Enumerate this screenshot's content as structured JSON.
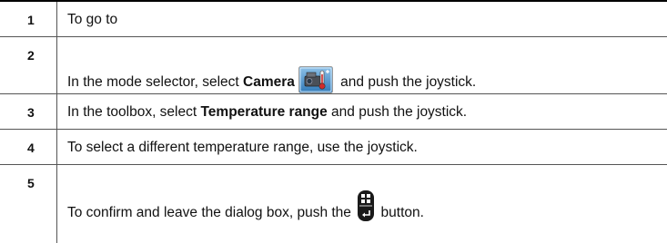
{
  "steps": [
    {
      "number": "1",
      "text": "To go to"
    },
    {
      "number": "2",
      "text_before": "In the mode selector, select ",
      "bold": "Camera",
      "text_after": " and push the joystick.",
      "icon": "camera-thermometer-icon"
    },
    {
      "number": "3",
      "text_before": "In the toolbox, select ",
      "bold": "Temperature range",
      "text_after": " and push the joystick."
    },
    {
      "number": "4",
      "text": "To select a different temperature range, use the joystick."
    },
    {
      "number": "5",
      "text_before": "To confirm and leave the dialog box, push the ",
      "text_after": " button.",
      "icon": "menu-back-button-icon"
    }
  ],
  "colors": {
    "border": "#555555",
    "top_border": "#000000",
    "text": "#111111",
    "icon_button": "#1a1a1a"
  }
}
